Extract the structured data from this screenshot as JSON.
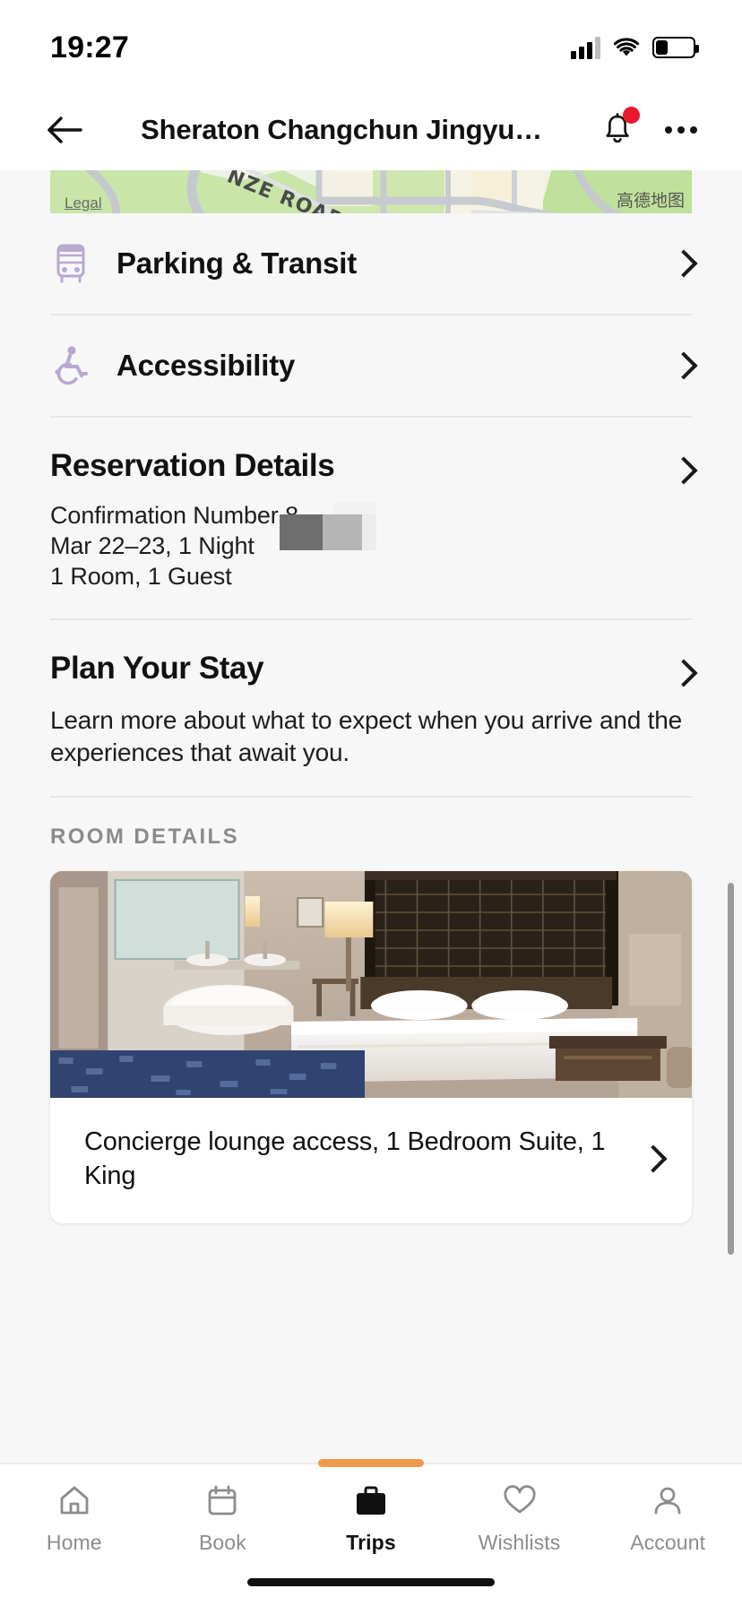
{
  "status_bar": {
    "time": "19:27",
    "signal_icon": "cellular-signal-icon",
    "wifi_icon": "wifi-icon",
    "battery_icon": "battery-low-icon",
    "battery_level_pct": 33
  },
  "nav": {
    "back_icon": "back-arrow-icon",
    "title": "Sheraton Changchun Jingyu…",
    "bell_icon": "notification-bell-icon",
    "bell_badge": true,
    "more_icon": "overflow-menu-icon"
  },
  "map": {
    "legal_label": "Legal",
    "attribution": "高德地图",
    "road_label": "…NZE ROAD"
  },
  "link_rows": [
    {
      "label": "Parking & Transit",
      "icon": "bus-icon",
      "chevron": "chevron-right-icon"
    },
    {
      "label": "Accessibility",
      "icon": "wheelchair-icon",
      "chevron": "chevron-right-icon"
    }
  ],
  "reservation": {
    "title": "Reservation Details",
    "chevron": "chevron-right-icon",
    "confirmation_line": "Confirmation Number 8",
    "dates_line": "Mar 22–23, 1 Night",
    "occupancy_line": "1 Room, 1 Guest",
    "redacted": true
  },
  "plan_your_stay": {
    "title": "Plan Your Stay",
    "chevron": "chevron-right-icon",
    "description": "Learn more about what to expect when you arrive and the experiences that await you."
  },
  "room_details": {
    "eyebrow": "ROOM DETAILS",
    "photo_alt": "hotel-suite-photo",
    "caption": "Concierge lounge access, 1 Bedroom Suite, 1 King",
    "chevron": "chevron-right-icon"
  },
  "tabbar": {
    "accent_color": "#f09a4e",
    "items": [
      {
        "label": "Home",
        "icon": "home-icon",
        "active": false
      },
      {
        "label": "Book",
        "icon": "calendar-icon",
        "active": false
      },
      {
        "label": "Trips",
        "icon": "briefcase-icon",
        "active": true
      },
      {
        "label": "Wishlists",
        "icon": "heart-icon",
        "active": false
      },
      {
        "label": "Account",
        "icon": "person-icon",
        "active": false
      }
    ]
  },
  "colors": {
    "page_bg": "#f7f7f7",
    "card_bg": "#ffffff",
    "icon_lavender": "#b8a8d2",
    "badge_red": "#e8192c",
    "text_primary": "#111111",
    "text_muted": "#8a8a8a"
  }
}
